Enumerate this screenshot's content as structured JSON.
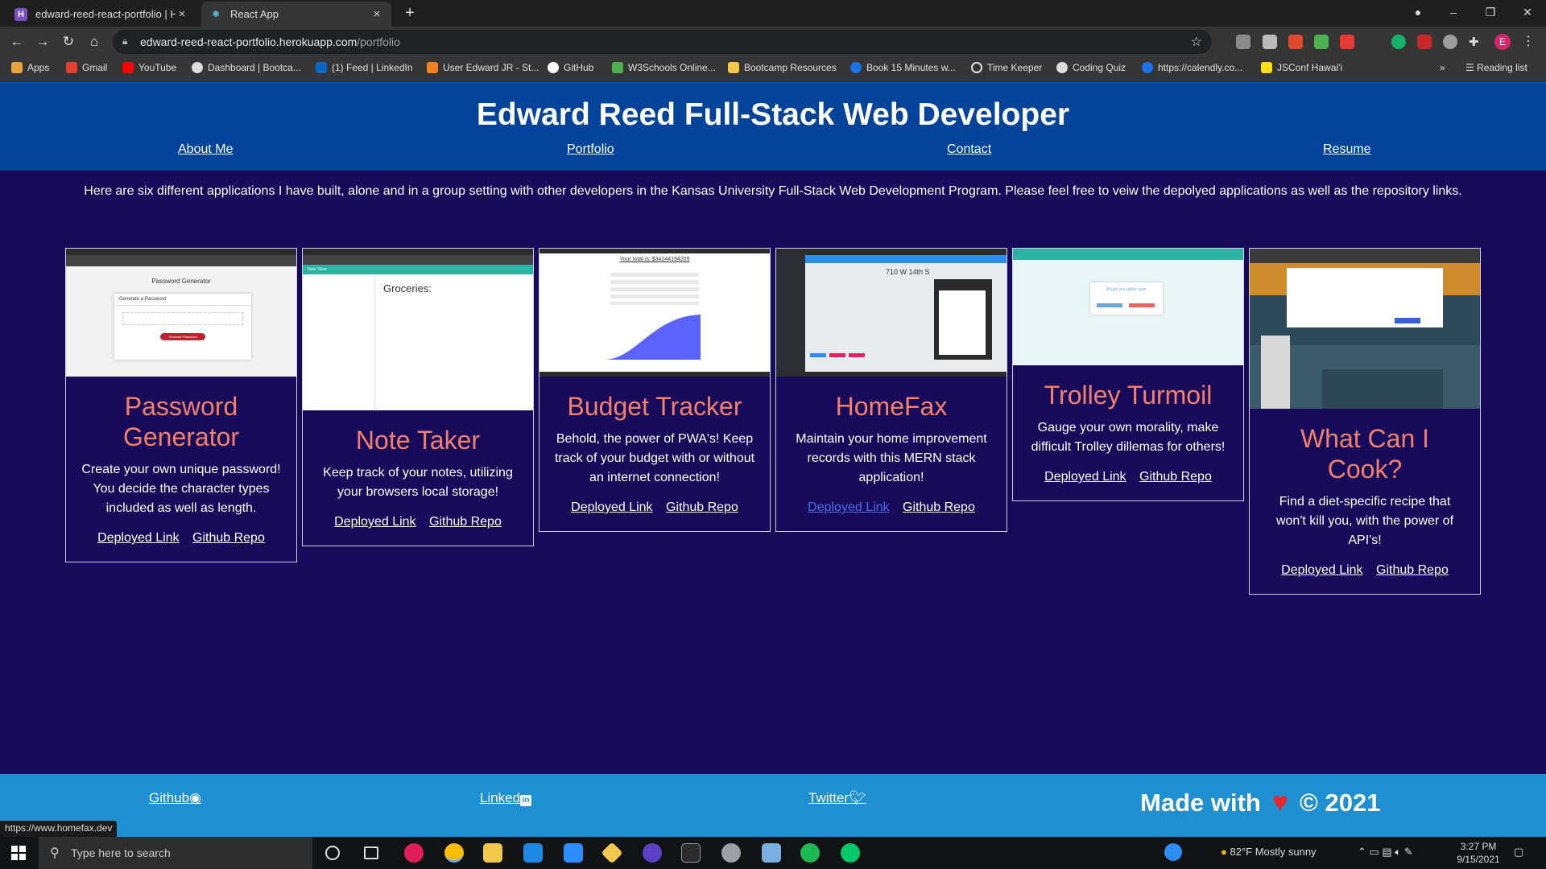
{
  "browser": {
    "tabs": [
      {
        "title": "edward-reed-react-portfolio | He",
        "favicon": "H"
      },
      {
        "title": "React App",
        "favicon": "⚛"
      }
    ],
    "url_host": "edward-reed-react-portfolio.herokuapp.com",
    "url_path": "/portfolio",
    "bookmarks": [
      "Apps",
      "Gmail",
      "YouTube",
      "Dashboard | Bootca...",
      "(1) Feed | LinkedIn",
      "User Edward JR - St...",
      "GitHub",
      "W3Schools Online...",
      "Bootcamp Resources",
      "Book 15 Minutes w...",
      "Time Keeper",
      "Coding Quiz",
      "https://calendly.co...",
      "JSConf Hawai'i"
    ],
    "reading_list": "Reading list",
    "profile_initial": "E"
  },
  "header": {
    "title": "Edward Reed Full-Stack Web Developer",
    "nav": [
      "About Me",
      "Portfolio",
      "Contact",
      "Resume"
    ]
  },
  "intro": "Here are six different applications I have built, alone and in a group setting with other developers in the Kansas University Full-Stack Web Development Program. Please feel free to veiw the depolyed applications as well as the repository links.",
  "projects": [
    {
      "title": "Password Generator",
      "desc": "Create your own unique password! You decide the character types included as well as length.",
      "deployed": "Deployed Link",
      "repo": "Github Repo",
      "shot_heading": "Password Generator",
      "shot_sub": "Generate a Password",
      "shot_button": "Generate Password"
    },
    {
      "title": "Note Taker",
      "desc": "Keep track of your notes, utilizing your browsers local storage!",
      "deployed": "Deployed Link",
      "repo": "Github Repo",
      "shot_heading": "Groceries:",
      "shot_app": "Note Taker"
    },
    {
      "title": "Budget Tracker",
      "desc": "Behold, the power of PWA's! Keep track of your budget with or without an internet connection!",
      "deployed": "Deployed Link",
      "repo": "Github Repo",
      "shot_total": "Your total is: $34244194209"
    },
    {
      "title": "HomeFax",
      "desc": "Maintain your home improvement records with this MERN stack application!",
      "deployed": "Deployed Link",
      "repo": "Github Repo",
      "shot_address": "710 W 14th S"
    },
    {
      "title": "Trolley Turmoil",
      "desc": "Gauge your own morality, make difficult Trolley dillemas for others!",
      "deployed": "Deployed Link",
      "repo": "Github Repo",
      "shot_question": "Would you rather save"
    },
    {
      "title": "What Can I Cook?",
      "desc": "Find a diet-specific recipe that won't kill you, with the power of API's!",
      "deployed": "Deployed Link",
      "repo": "Github Repo"
    }
  ],
  "footer": {
    "github": "Github",
    "linkedin": "Linked",
    "twitter": "Twitter",
    "made_with": "Made with",
    "copyright": "© 2021"
  },
  "status_url": "https://www.homefax.dev",
  "taskbar": {
    "search_placeholder": "Type here to search",
    "weather": "82°F  Mostly sunny",
    "time": "3:27 PM",
    "date": "9/15/2021"
  },
  "colors": {
    "page_bg": "#180a5a",
    "header_bg": "#03449a",
    "footer_bg": "#1e8fd0",
    "card_title": "#f2806a"
  }
}
